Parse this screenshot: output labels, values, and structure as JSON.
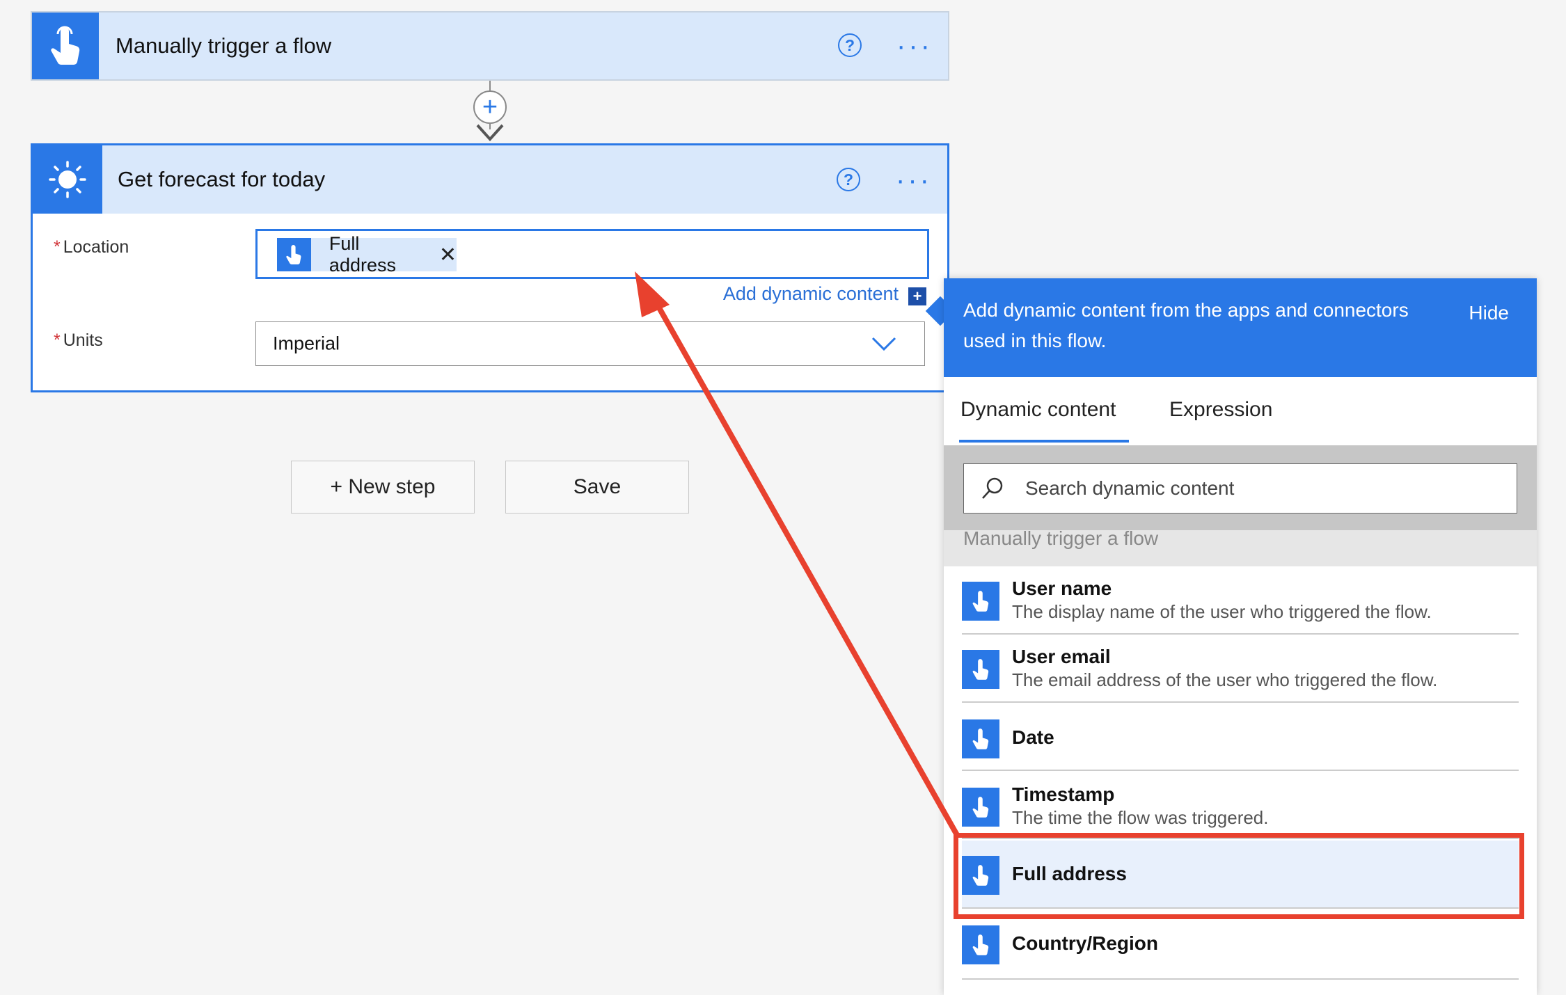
{
  "trigger_card": {
    "title": "Manually trigger a flow",
    "more": "···",
    "help": "?"
  },
  "connector": {
    "plus": "+"
  },
  "forecast_card": {
    "title": "Get forecast for today",
    "help": "?",
    "more": "···",
    "location_label": "Location",
    "required_mark": "*",
    "location_token": "Full address",
    "token_close": "✕",
    "add_dynamic_content": "Add dynamic content",
    "add_dynamic_plus": "+",
    "units_label": "Units",
    "units_value": "Imperial"
  },
  "buttons": {
    "new_step": "+ New step",
    "save": "Save"
  },
  "panel": {
    "header_text": "Add dynamic content from the apps and connectors used in this flow.",
    "hide": "Hide",
    "tabs": [
      "Dynamic content",
      "Expression"
    ],
    "search_placeholder": "Search dynamic content",
    "section_label": "Manually trigger a flow",
    "items": [
      {
        "name": "User name",
        "desc": "The display name of the user who triggered the flow."
      },
      {
        "name": "User email",
        "desc": "The email address of the user who triggered the flow."
      },
      {
        "name": "Date",
        "desc": ""
      },
      {
        "name": "Timestamp",
        "desc": "The time the flow was triggered."
      },
      {
        "name": "Full address",
        "desc": ""
      },
      {
        "name": "Country/Region",
        "desc": ""
      }
    ]
  },
  "colors": {
    "accent": "#2a78e6",
    "annotation_red": "#e8412e",
    "card_header": "#d9e8fb"
  }
}
